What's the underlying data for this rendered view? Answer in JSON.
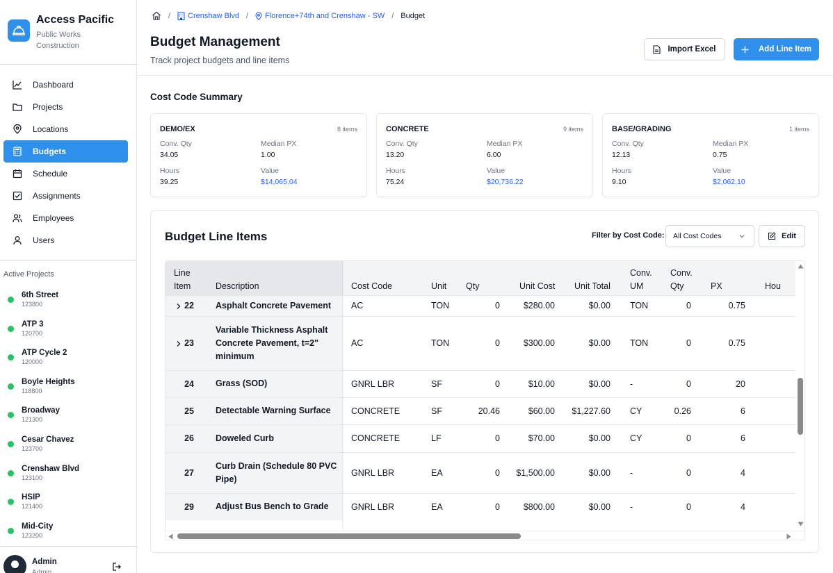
{
  "brand": {
    "title": "Access Pacific",
    "subtitle": "Public Works Construction",
    "logo_icon": "hard-hat-icon",
    "color": "#2e90ea"
  },
  "nav": [
    {
      "label": "Dashboard",
      "icon": "chart-line-icon",
      "active": false
    },
    {
      "label": "Projects",
      "icon": "folder-icon",
      "active": false
    },
    {
      "label": "Locations",
      "icon": "map-pin-icon",
      "active": false
    },
    {
      "label": "Budgets",
      "icon": "calculator-icon",
      "active": true
    },
    {
      "label": "Schedule",
      "icon": "calendar-icon",
      "active": false
    },
    {
      "label": "Assignments",
      "icon": "checkbox-icon",
      "active": false
    },
    {
      "label": "Employees",
      "icon": "users-icon",
      "active": false
    },
    {
      "label": "Users",
      "icon": "user-icon",
      "active": false
    }
  ],
  "active_projects": {
    "title": "Active Projects",
    "items": [
      {
        "name": "6th Street",
        "number": "123800"
      },
      {
        "name": "ATP 3",
        "number": "120700"
      },
      {
        "name": "ATP Cycle 2",
        "number": "120000"
      },
      {
        "name": "Boyle Heights",
        "number": "118800"
      },
      {
        "name": "Broadway",
        "number": "121300"
      },
      {
        "name": "Cesar Chavez",
        "number": "123700"
      },
      {
        "name": "Crenshaw Blvd",
        "number": "123100"
      },
      {
        "name": "HSIP",
        "number": "121400"
      },
      {
        "name": "Mid-City",
        "number": "123200"
      }
    ],
    "status_color": "#22c55e"
  },
  "user": {
    "name": "Admin",
    "role": "Admin"
  },
  "breadcrumb": {
    "project": "Crenshaw Blvd",
    "location": "Florence+74th and Crenshaw - SW",
    "current": "Budget"
  },
  "header": {
    "title": "Budget Management",
    "subtitle": "Track project budgets and line items",
    "import_label": "Import Excel",
    "add_label": "Add Line Item"
  },
  "summary": {
    "title": "Cost Code Summary",
    "labels": {
      "conv_qty": "Conv. Qty",
      "median_px": "Median PX",
      "hours": "Hours",
      "value": "Value"
    },
    "cards": [
      {
        "name": "DEMO/EX",
        "count": "8 items",
        "conv_qty": "34.05",
        "median_px": "1.00",
        "hours": "39.25",
        "value": "$14,065.04"
      },
      {
        "name": "CONCRETE",
        "count": "9 items",
        "conv_qty": "13.20",
        "median_px": "6.00",
        "hours": "75.24",
        "value": "$20,736.22"
      },
      {
        "name": "BASE/GRADING",
        "count": "1 items",
        "conv_qty": "12.13",
        "median_px": "0.75",
        "hours": "9.10",
        "value": "$2,062.10"
      }
    ]
  },
  "line_items": {
    "title": "Budget Line Items",
    "filter_label": "Filter by Cost Code:",
    "filter_value": "All Cost Codes",
    "edit_label": "Edit",
    "columns": [
      "Line Item",
      "Description",
      "Cost Code",
      "Unit",
      "Qty",
      "Unit Cost",
      "Unit Total",
      "Conv. UM",
      "Conv. Qty",
      "PX",
      "Hou"
    ],
    "rows": [
      {
        "line": "22",
        "expandable": true,
        "description": "Asphalt Concrete Pavement",
        "cost_code": "AC",
        "unit": "TON",
        "qty": "0",
        "unit_cost": "$280.00",
        "unit_total": "$0.00",
        "conv_um": "TON",
        "conv_qty": "0",
        "px": "0.75",
        "hours": ""
      },
      {
        "line": "23",
        "expandable": true,
        "description": "Variable Thickness Asphalt Concrete Pavement, t=2\" minimum",
        "cost_code": "AC",
        "unit": "TON",
        "qty": "0",
        "unit_cost": "$300.00",
        "unit_total": "$0.00",
        "conv_um": "TON",
        "conv_qty": "0",
        "px": "0.75",
        "hours": ""
      },
      {
        "line": "24",
        "expandable": false,
        "description": "Grass (SOD)",
        "cost_code": "GNRL LBR",
        "unit": "SF",
        "qty": "0",
        "unit_cost": "$10.00",
        "unit_total": "$0.00",
        "conv_um": "-",
        "conv_qty": "0",
        "px": "20",
        "hours": ""
      },
      {
        "line": "25",
        "expandable": false,
        "description": "Detectable Warning Surface",
        "cost_code": "CONCRETE",
        "unit": "SF",
        "qty": "20.46",
        "unit_cost": "$60.00",
        "unit_total": "$1,227.60",
        "conv_um": "CY",
        "conv_qty": "0.26",
        "px": "6",
        "hours": ""
      },
      {
        "line": "26",
        "expandable": false,
        "description": "Doweled Curb",
        "cost_code": "CONCRETE",
        "unit": "LF",
        "qty": "0",
        "unit_cost": "$70.00",
        "unit_total": "$0.00",
        "conv_um": "CY",
        "conv_qty": "0",
        "px": "6",
        "hours": ""
      },
      {
        "line": "27",
        "expandable": false,
        "description": "Curb Drain (Schedule 80 PVC Pipe)",
        "cost_code": "GNRL LBR",
        "unit": "EA",
        "qty": "0",
        "unit_cost": "$1,500.00",
        "unit_total": "$0.00",
        "conv_um": "-",
        "conv_qty": "0",
        "px": "4",
        "hours": ""
      },
      {
        "line": "29",
        "expandable": false,
        "description": "Adjust Bus Bench to Grade",
        "cost_code": "GNRL LBR",
        "unit": "EA",
        "qty": "0",
        "unit_cost": "$800.00",
        "unit_total": "$0.00",
        "conv_um": "-",
        "conv_qty": "0",
        "px": "4",
        "hours": ""
      }
    ]
  }
}
